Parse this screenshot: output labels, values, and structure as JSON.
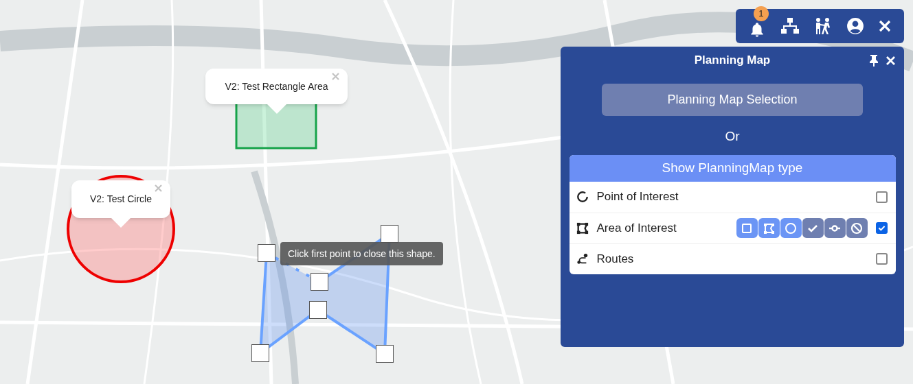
{
  "toolbar": {
    "notification_count": "1"
  },
  "panel": {
    "title": "Planning Map",
    "selection_button": "Planning Map Selection",
    "separator": "Or",
    "card_title": "Show PlanningMap type",
    "layers": [
      {
        "kind": "poi",
        "label": "Point of Interest",
        "checked": false
      },
      {
        "kind": "area",
        "label": "Area of Interest",
        "checked": true,
        "tools": [
          {
            "kind": "rectangle",
            "active": true
          },
          {
            "kind": "polygon",
            "active": true
          },
          {
            "kind": "circle",
            "active": true
          },
          {
            "kind": "finish",
            "active": false
          },
          {
            "kind": "line",
            "active": false
          },
          {
            "kind": "cancel",
            "active": false
          }
        ]
      },
      {
        "kind": "routes",
        "label": "Routes",
        "checked": false
      }
    ]
  },
  "map": {
    "popups": [
      {
        "kind": "rectangle",
        "label": "V2: Test Rectangle Area"
      },
      {
        "kind": "circle",
        "label": "V2: Test Circle"
      }
    ],
    "draw_tooltip": "Click first point to close this shape."
  }
}
